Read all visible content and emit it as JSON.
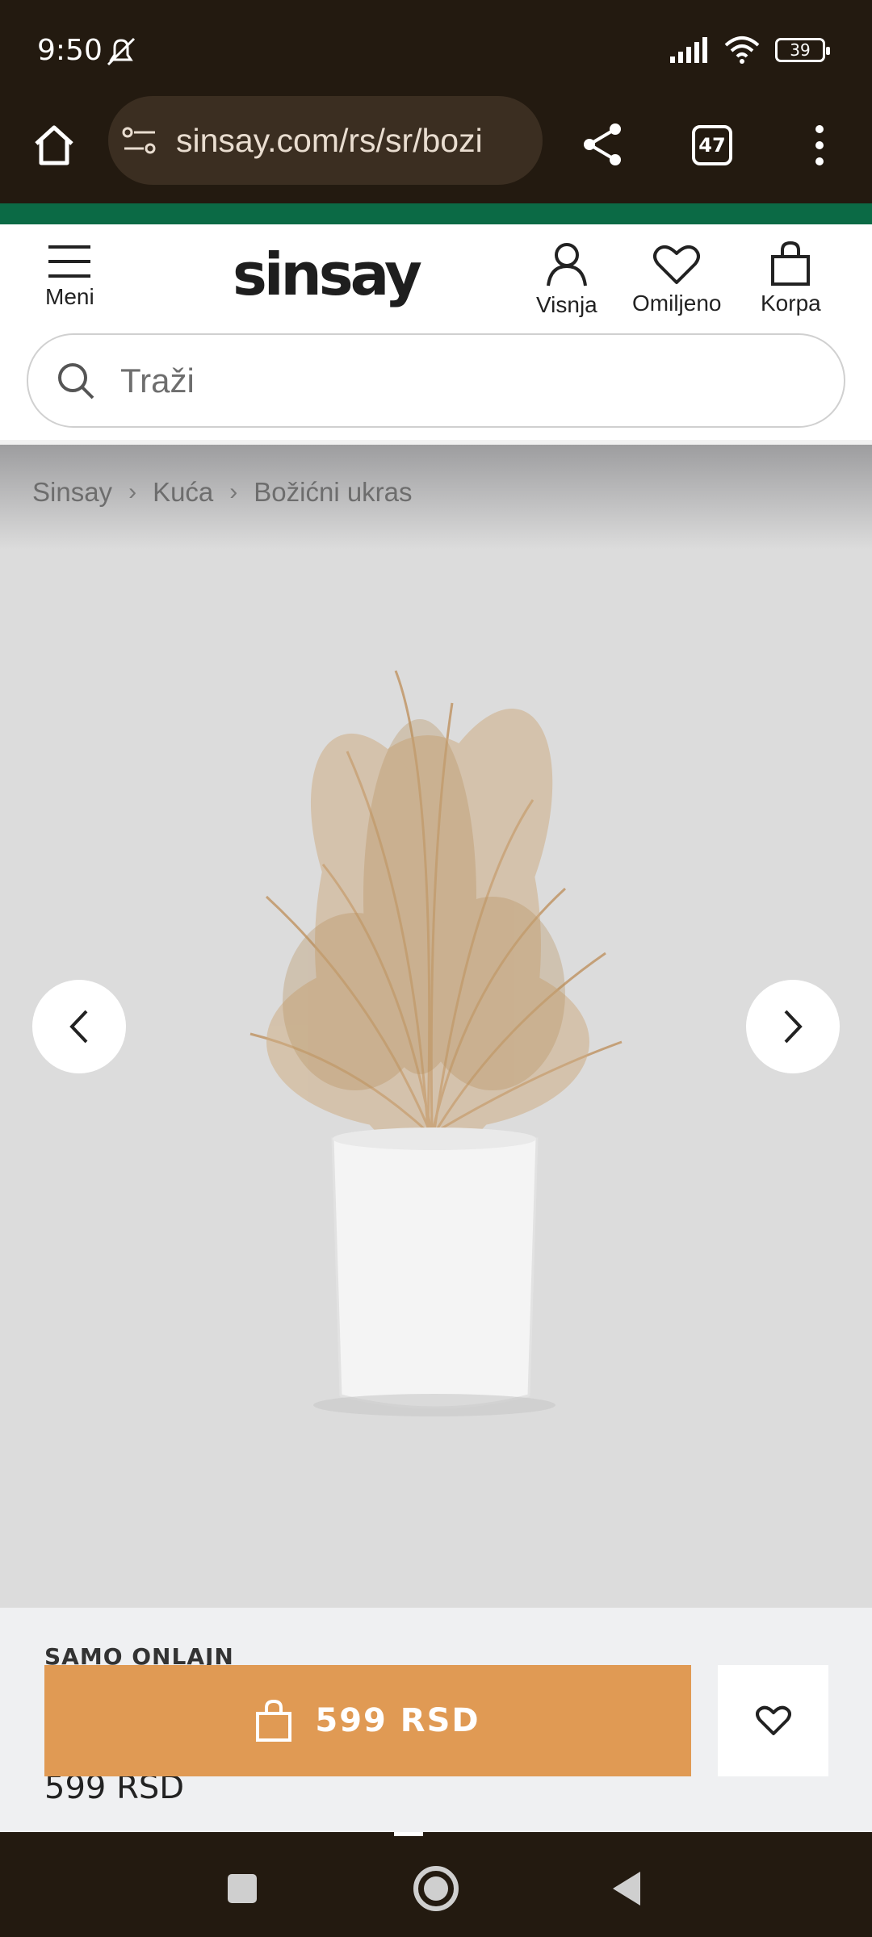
{
  "status_bar": {
    "time": "9:50",
    "battery": "39"
  },
  "browser": {
    "url": "sinsay.com/rs/sr/bozi",
    "tab_count": "47"
  },
  "header": {
    "menu_label": "Meni",
    "logo": "sinsay",
    "account_label": "Visnja",
    "favorites_label": "Omiljeno",
    "cart_label": "Korpa"
  },
  "search": {
    "placeholder": "Traži"
  },
  "breadcrumb": [
    "Sinsay",
    "Kuća",
    "Božićni ukras"
  ],
  "product": {
    "badge": "SAMO ONLAJN",
    "price_hidden": "599 RSD",
    "buy_label": "599 RSD"
  },
  "colors": {
    "chrome": "#231a10",
    "accent_green": "#0b6a45",
    "buy_button": "#e09a54",
    "gallery_bg": "#dcdcdc"
  }
}
